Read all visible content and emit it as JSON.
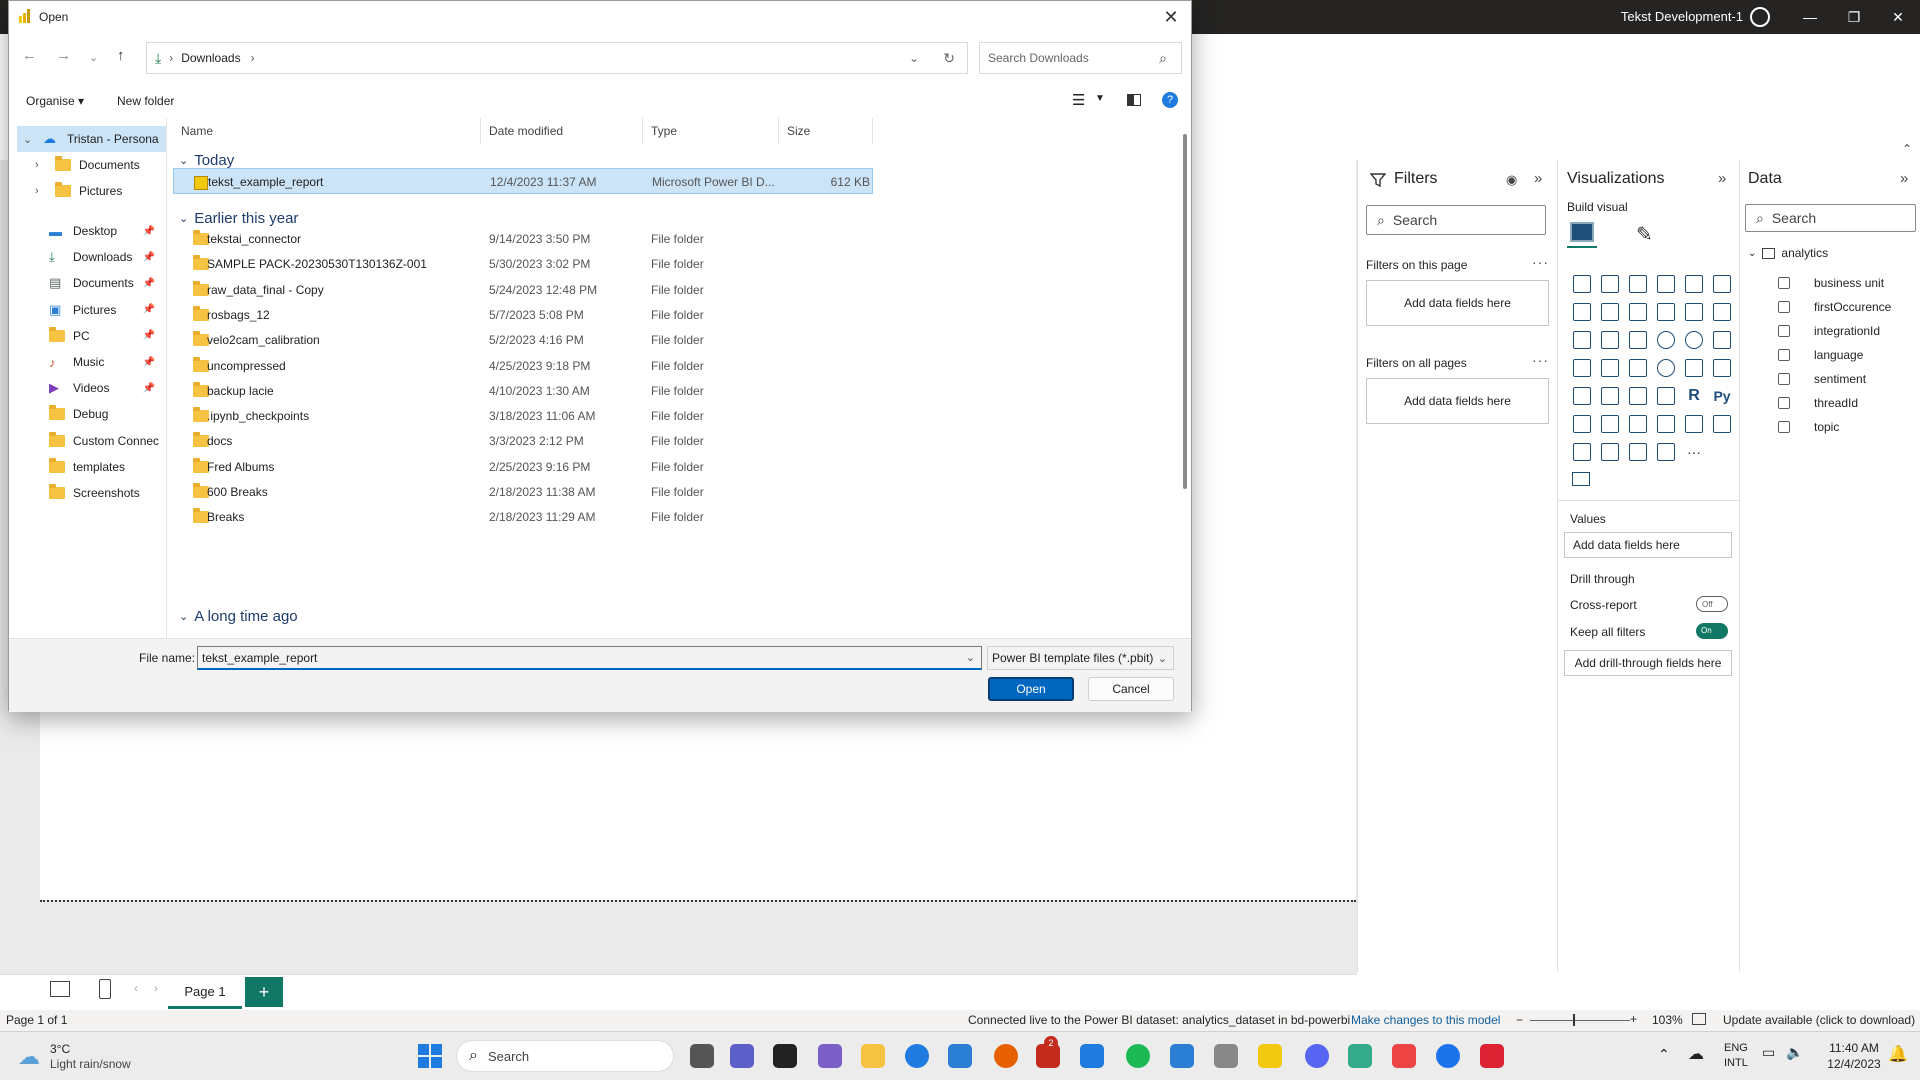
{
  "app": {
    "user": "Tekst Development-1",
    "accent": "#117865"
  },
  "dialog": {
    "title": "Open",
    "address": {
      "location": "Downloads"
    },
    "search_placeholder": "Search Downloads",
    "toolbar": {
      "organise": "Organise",
      "new_folder": "New folder"
    },
    "nav": [
      {
        "label": "Tristan - Persona",
        "type": "cloud",
        "expanded": true
      },
      {
        "label": "Documents",
        "type": "folder",
        "child": true
      },
      {
        "label": "Pictures",
        "type": "folder",
        "child": true
      },
      {
        "label": "Desktop",
        "type": "desktop",
        "pinned": true
      },
      {
        "label": "Downloads",
        "type": "download",
        "pinned": true
      },
      {
        "label": "Documents",
        "type": "docs",
        "pinned": true
      },
      {
        "label": "Pictures",
        "type": "pictures",
        "pinned": true
      },
      {
        "label": "PC",
        "type": "folder",
        "pinned": true
      },
      {
        "label": "Music",
        "type": "music",
        "pinned": true
      },
      {
        "label": "Videos",
        "type": "videos",
        "pinned": true
      },
      {
        "label": "Debug",
        "type": "folder"
      },
      {
        "label": "Custom Connec",
        "type": "folder"
      },
      {
        "label": "templates",
        "type": "folder"
      },
      {
        "label": "Screenshots",
        "type": "folder"
      }
    ],
    "columns": {
      "name": "Name",
      "date": "Date modified",
      "type": "Type",
      "size": "Size"
    },
    "groups": {
      "today": "Today",
      "earlier": "Earlier this year",
      "longago": "A long time ago"
    },
    "today_files": [
      {
        "name": "tekst_example_report",
        "date": "12/4/2023 11:37 AM",
        "type": "Microsoft Power BI D...",
        "size": "612 KB",
        "selected": true
      }
    ],
    "earlier_files": [
      {
        "name": "tekstai_connector",
        "date": "9/14/2023 3:50 PM",
        "type": "File folder"
      },
      {
        "name": "SAMPLE PACK-20230530T130136Z-001",
        "date": "5/30/2023 3:02 PM",
        "type": "File folder"
      },
      {
        "name": "raw_data_final - Copy",
        "date": "5/24/2023 12:48 PM",
        "type": "File folder"
      },
      {
        "name": "rosbags_12",
        "date": "5/7/2023 5:08 PM",
        "type": "File folder"
      },
      {
        "name": "velo2cam_calibration",
        "date": "5/2/2023 4:16 PM",
        "type": "File folder"
      },
      {
        "name": "uncompressed",
        "date": "4/25/2023 9:18 PM",
        "type": "File folder"
      },
      {
        "name": "backup lacie",
        "date": "4/10/2023 1:30 AM",
        "type": "File folder"
      },
      {
        "name": ".ipynb_checkpoints",
        "date": "3/18/2023 11:06 AM",
        "type": "File folder"
      },
      {
        "name": "docs",
        "date": "3/3/2023 2:12 PM",
        "type": "File folder"
      },
      {
        "name": "Fred Albums",
        "date": "2/25/2023 9:16 PM",
        "type": "File folder"
      },
      {
        "name": "600 Breaks",
        "date": "2/18/2023 11:38 AM",
        "type": "File folder"
      },
      {
        "name": "Breaks",
        "date": "2/18/2023 11:29 AM",
        "type": "File folder"
      }
    ],
    "file_name_label": "File name:",
    "file_name_value": "tekst_example_report",
    "file_type": "Power BI template files (*.pbit)",
    "open_button": "Open",
    "cancel_button": "Cancel"
  },
  "filters": {
    "title": "Filters",
    "search_placeholder": "Search",
    "on_page": "Filters on this page",
    "on_all_pages": "Filters on all pages",
    "add_fields": "Add data fields here"
  },
  "visualizations": {
    "title": "Visualizations",
    "build_visual": "Build visual",
    "values_label": "Values",
    "values_add": "Add data fields here",
    "drill_through": "Drill through",
    "cross_report": "Cross-report",
    "cross_report_state": "Off",
    "keep_all_filters": "Keep all filters",
    "keep_all_filters_state": "On",
    "drill_add": "Add drill-through fields here",
    "r_label": "R",
    "py_label": "Py"
  },
  "data_pane": {
    "title": "Data",
    "search_placeholder": "Search",
    "table": "analytics",
    "fields": [
      "business unit",
      "firstOccurence",
      "integrationId",
      "language",
      "sentiment",
      "threadId",
      "topic"
    ]
  },
  "pages": {
    "tab": "Page 1",
    "add": "+"
  },
  "status": {
    "page": "Page 1 of 1",
    "connection": "Connected live to the Power BI dataset: analytics_dataset in bd-powerbi",
    "make_changes": "Make changes to this model",
    "zoom": "103%",
    "update": "Update available (click to download)"
  },
  "taskbar": {
    "temp": "3°C",
    "weather": "Light rain/snow",
    "search": "Search",
    "lang1": "ENG",
    "lang2": "INTL",
    "time": "11:40 AM",
    "date": "12/4/2023",
    "badge": "2"
  }
}
